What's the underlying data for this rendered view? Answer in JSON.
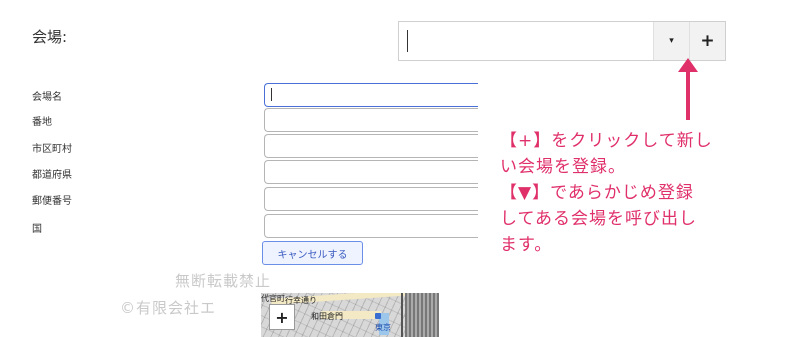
{
  "venue": {
    "label": "会場:",
    "dropdown_icon": "▾",
    "add_icon": "+"
  },
  "form": {
    "rows": [
      {
        "label": "会場名"
      },
      {
        "label": "番地"
      },
      {
        "label": "市区町村"
      },
      {
        "label": "都道府県"
      },
      {
        "label": "郵便番号"
      },
      {
        "label": "国"
      }
    ],
    "cancel_label": "キャンセルする"
  },
  "map": {
    "zoom_in": "+",
    "labels": [
      "代官町",
      "行幸通り",
      "和田倉門",
      "東京"
    ]
  },
  "watermark": {
    "line1": "無断転載禁止",
    "line2": "©有限会社エ"
  },
  "annotation": {
    "lines": [
      "【+】をクリックして新し",
      "い会場を登録。",
      "【▼】であらかじめ登録",
      "してある会場を呼び出し",
      "ます。"
    ],
    "color": "#e0306a"
  }
}
